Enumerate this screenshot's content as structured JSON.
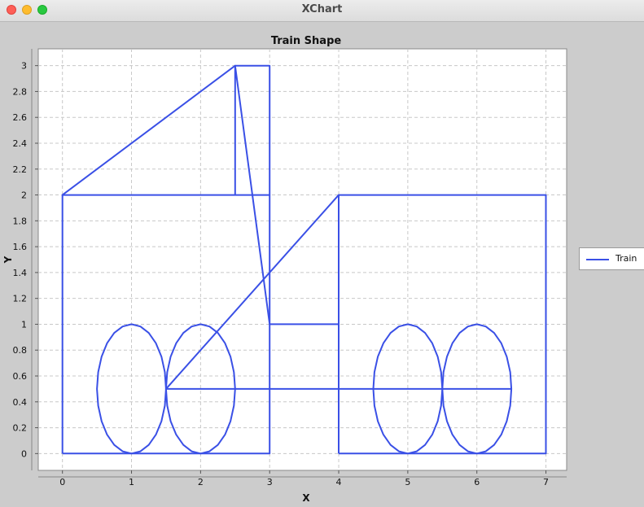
{
  "window": {
    "title": "XChart"
  },
  "chart_data": {
    "type": "line",
    "title": "Train Shape",
    "xlabel": "X",
    "ylabel": "Y",
    "xlim": [
      -0.35,
      7.3
    ],
    "ylim": [
      -0.13,
      3.13
    ],
    "xticks": [
      "0",
      "1",
      "2",
      "3",
      "4",
      "5",
      "6",
      "7"
    ],
    "yticks": [
      "0",
      "0.2",
      "0.4",
      "0.6",
      "0.8",
      "1",
      "1.2",
      "1.4",
      "1.6",
      "1.8",
      "2",
      "2.2",
      "2.4",
      "2.6",
      "2.8",
      "3"
    ],
    "grid": true,
    "legend_position": "outside-right",
    "series": [
      {
        "name": "Train",
        "color": "#3a50e6",
        "segments": [
          {
            "shape": "polyline",
            "points": [
              [
                0,
                0
              ],
              [
                3,
                0
              ],
              [
                3,
                2
              ],
              [
                0,
                2
              ],
              [
                0,
                0
              ]
            ]
          },
          {
            "shape": "polyline",
            "points": [
              [
                0,
                2
              ],
              [
                2.5,
                3
              ],
              [
                3,
                3
              ],
              [
                3,
                2
              ]
            ]
          },
          {
            "shape": "polyline",
            "points": [
              [
                2.5,
                2
              ],
              [
                2.5,
                3
              ],
              [
                3,
                1
              ],
              [
                4,
                1
              ],
              [
                4,
                2
              ],
              [
                1.5,
                0.5
              ],
              [
                6.5,
                0.5
              ]
            ]
          },
          {
            "shape": "polyline",
            "points": [
              [
                4,
                0
              ],
              [
                7,
                0
              ],
              [
                7,
                2
              ],
              [
                4,
                2
              ],
              [
                4,
                0
              ]
            ]
          },
          {
            "shape": "ellipse",
            "cx": 1,
            "cy": 0.5,
            "rx": 0.5,
            "ry": 0.5
          },
          {
            "shape": "ellipse",
            "cx": 2,
            "cy": 0.5,
            "rx": 0.5,
            "ry": 0.5
          },
          {
            "shape": "ellipse",
            "cx": 5,
            "cy": 0.5,
            "rx": 0.5,
            "ry": 0.5
          },
          {
            "shape": "ellipse",
            "cx": 6,
            "cy": 0.5,
            "rx": 0.5,
            "ry": 0.5
          }
        ]
      }
    ]
  }
}
